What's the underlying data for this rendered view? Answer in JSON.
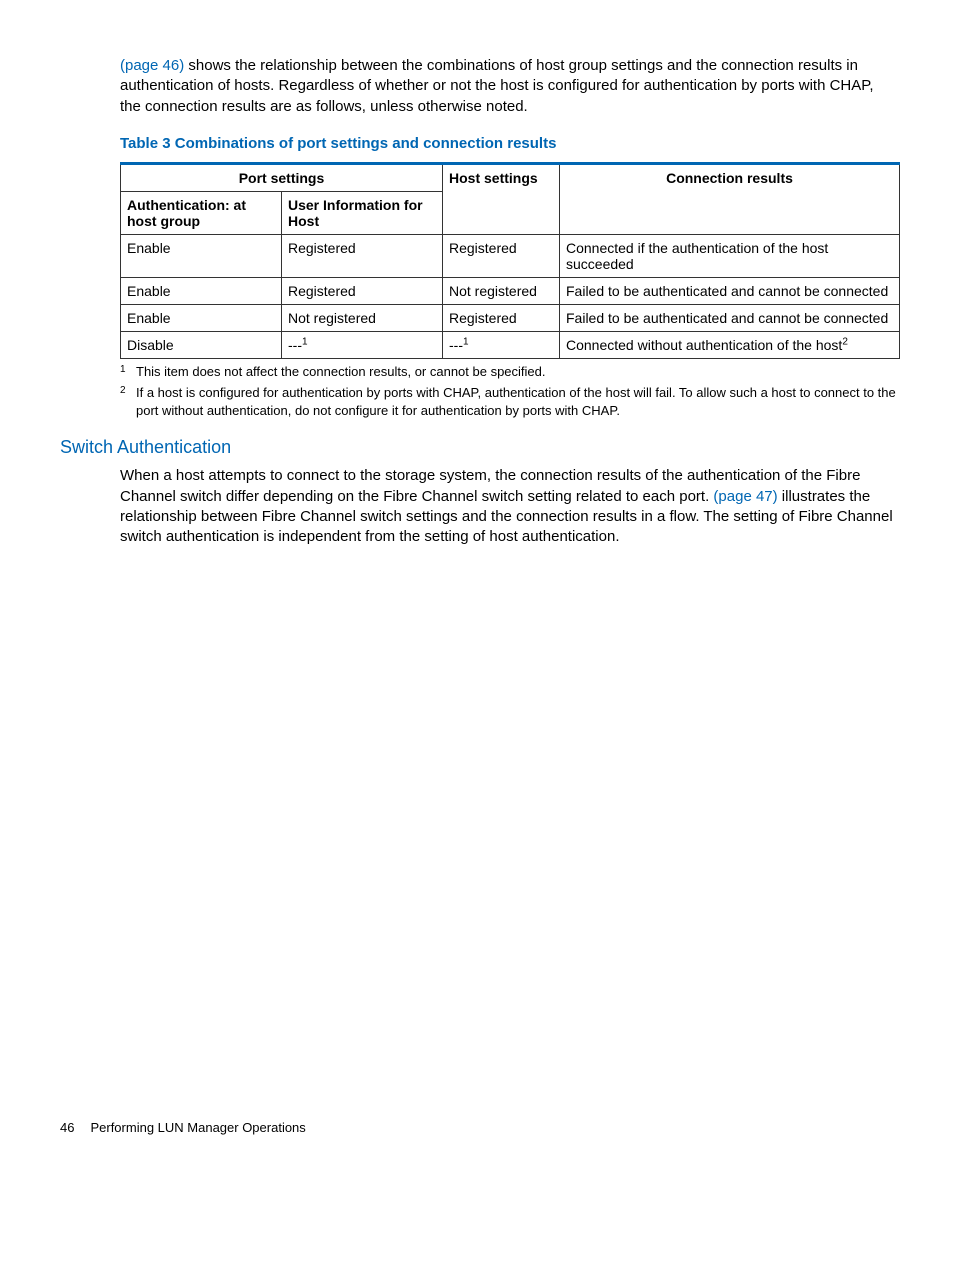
{
  "intro": {
    "link": "(page 46)",
    "text": " shows the relationship between the combinations of host group settings and the connection results in authentication of hosts. Regardless of whether or not the host is configured for authentication by ports with CHAP, the connection results are as follows, unless otherwise noted."
  },
  "table": {
    "caption": "Table 3 Combinations of port settings and connection results",
    "header_groups": {
      "port_settings": "Port settings",
      "host_settings": "Host settings",
      "connection_results": "Connection results"
    },
    "sub_headers": {
      "auth": "Authentication: at host group",
      "user_info": "User Information for Host"
    },
    "rows": [
      {
        "auth": "Enable",
        "user": "Registered",
        "host": "Registered",
        "conn": "Connected if the authentication of the host succeeded"
      },
      {
        "auth": "Enable",
        "user": "Registered",
        "host": "Not registered",
        "conn": "Failed to be authenticated and cannot be connected"
      },
      {
        "auth": "Enable",
        "user": "Not registered",
        "host": "Registered",
        "conn": "Failed to be authenticated and cannot be connected"
      },
      {
        "auth": "Disable",
        "user_dash": "---",
        "user_sup": "1",
        "host_dash": "---",
        "host_sup": "1",
        "conn_text": "Connected without authentication of the host",
        "conn_sup": "2"
      }
    ]
  },
  "footnotes": {
    "f1_num": "1",
    "f1_text": "This item does not affect the connection results, or cannot be specified.",
    "f2_num": "2",
    "f2_text": "If a host is configured for authentication by ports with CHAP, authentication of the host will fail. To allow such a host to connect to the port without authentication, do not configure it for authentication by ports with CHAP."
  },
  "section": {
    "heading": "Switch Authentication",
    "para_pre": "When a host attempts to connect to the storage system, the connection results of the authentication of the Fibre Channel switch differ depending on the Fibre Channel switch setting related to each port. ",
    "para_link": "(page 47)",
    "para_post": " illustrates the relationship between Fibre Channel switch settings and the connection results in a flow. The setting of Fibre Channel switch authentication is independent from the setting of host authentication."
  },
  "footer": {
    "page": "46",
    "title": "Performing LUN Manager Operations"
  }
}
